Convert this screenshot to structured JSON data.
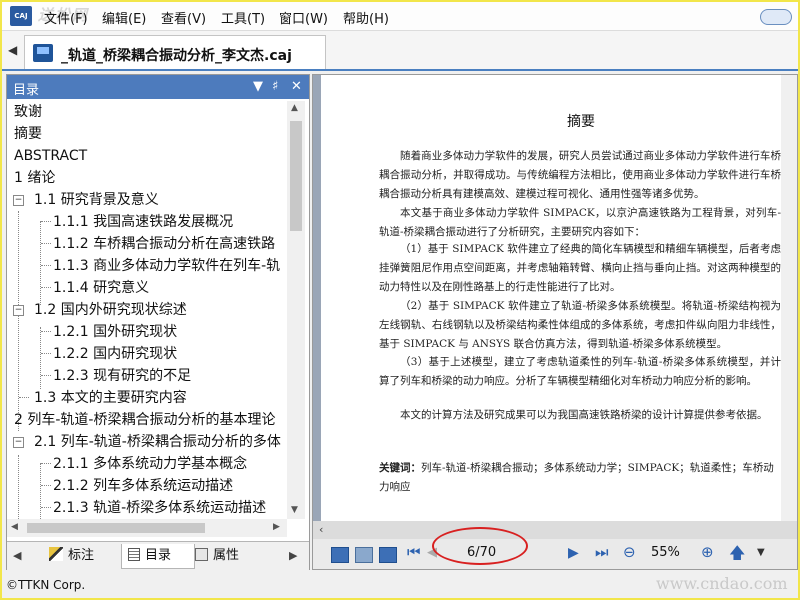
{
  "app": {
    "logo_text": "CAJ",
    "watermark_top": "送松网",
    "status_text": "©TTKN Corp.",
    "watermark_bottom": "www.cndao.com"
  },
  "menu": [
    "文件(F)",
    "编辑(E)",
    "查看(V)",
    "工具(T)",
    "窗口(W)",
    "帮助(H)"
  ],
  "tab": {
    "title": "_轨道_桥梁耦合振动分析_李文杰.caj"
  },
  "sidebar": {
    "title": "目录",
    "controls": [
      "▼",
      "♯",
      "✕"
    ],
    "toc": [
      "致谢",
      "摘要",
      "ABSTRACT",
      "1 绪论",
      "1.1 研究背景及意义",
      "1.1.1 我国高速铁路发展概况",
      "1.1.2 车桥耦合振动分析在高速铁路",
      "1.1.3 商业多体动力学软件在列车-轨",
      "1.1.4 研究意义",
      "1.2 国内外研究现状综述",
      "1.2.1 国外研究现状",
      "1.2.2 国内研究现状",
      "1.2.3 现有研究的不足",
      "1.3 本文的主要研究内容",
      "2 列车-轨道-桥梁耦合振动分析的基本理论",
      "2.1 列车-轨道-桥梁耦合振动分析的多体",
      "2.1.1 多体系统动力学基本概念",
      "2.1.2 列车多体系统运动描述",
      "2.1.3 轨道-桥梁多体系统运动描述"
    ],
    "tabs": [
      "标注",
      "目录",
      "属性"
    ]
  },
  "document": {
    "heading": "摘要",
    "paragraphs": [
      "随着商业多体动力学软件的发展，研究人员尝试通过商业多体动力学软件进行车桥耦合振动分析，并取得成功。与传统编程方法相比，使用商业多体动力学软件进行车桥耦合振动分析具有建模高效、建模过程可视化、通用性强等诸多优势。",
      "本文基于商业多体动力学软件 SIMPACK，以京沪高速铁路为工程背景，对列车-轨道-桥梁耦合振动进行了分析研究，主要研究内容如下：",
      "（1）基于 SIMPACK 软件建立了经典的简化车辆模型和精细车辆模型，后者考虑挂弹簧阻尼作用点空间距离，并考虑轴箱转臂、横向止挡与垂向止挡。对这两种模型的动力特性以及在刚性路基上的行走性能进行了比对。",
      "（2）基于 SIMPACK 软件建立了轨道-桥梁多体系统模型。将轨道-桥梁结构视为左线钢轨、右线钢轨以及桥梁结构柔性体组成的多体系统，考虑扣件纵向阻力非线性，基于 SIMPACK 与 ANSYS 联合仿真方法，得到轨道-桥梁多体系统模型。",
      "（3）基于上述模型，建立了考虑轨道柔性的列车-轨道-桥梁多体系统模型，并计算了列车和桥梁的动力响应。分析了车辆模型精细化对车桥动力响应分析的影响。",
      "本文的计算方法及研究成果可以为我国高速铁路桥梁的设计计算提供参考依据。"
    ],
    "keywords_label": "关键词：",
    "keywords": "列车-轨道-桥梁耦合振动；多体系统动力学；SIMPACK；轨道柔性；车桥动力响应"
  },
  "toolbar": {
    "page_indicator": "6/70",
    "zoom": "55%"
  },
  "colors": {
    "accent": "#4d7bbd",
    "frame_border": "#f2e64a",
    "annotation_red": "#d82020"
  }
}
